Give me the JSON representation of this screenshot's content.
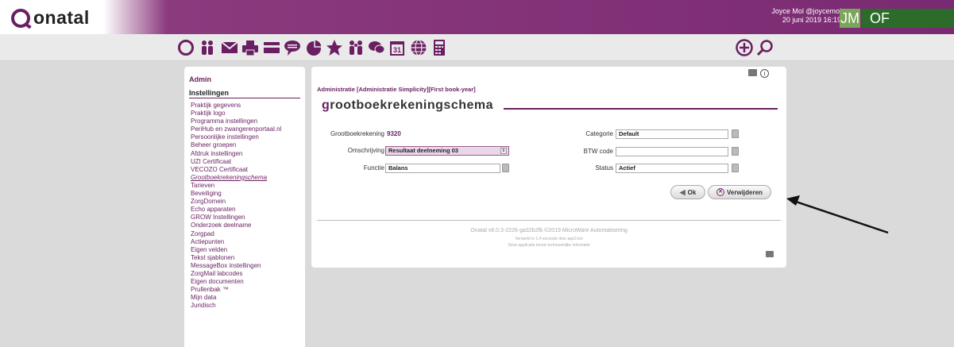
{
  "app": {
    "logo_text": "onatal"
  },
  "user": {
    "name": "Joyce Mol @joycemol",
    "datetime": "20 juni 2019 16:19",
    "initials": "JM",
    "org": "OF"
  },
  "toolbar": {
    "icons": [
      "home-q-icon",
      "persons-icon",
      "mail-icon",
      "print-icon",
      "card-icon",
      "chat-bubble-icon",
      "pie-chart-icon",
      "star-icon",
      "people-icon",
      "comments-icon",
      "calendar-icon",
      "globe-icon",
      "calculator-icon"
    ],
    "calendar_day": "31",
    "add_icon": "plus-circle-icon",
    "search_icon": "search-icon"
  },
  "sidebar": {
    "admin": "Admin",
    "section": "Instellingen",
    "items": [
      "Praktijk gegevens",
      "Praktijk logo",
      "Programma instellingen",
      "PeriHub en zwangerenportaal.nl",
      "Persoonlijke instellingen",
      "Beheer groepen",
      "Afdruk instellingen",
      "UZI Certificaat",
      "VECOZO Certificaat",
      "Grootboekrekeningschema",
      "Tarieven",
      "Beveiliging",
      "ZorgDomein",
      "Echo apparaten",
      "GROW Instellingen",
      "Onderzoek deelname",
      "Zorgpad",
      "Actiepunten",
      "Eigen velden",
      "Tekst sjablonen",
      "MessageBox instellingen",
      "ZorgMail labcodes",
      "Eigen documenten",
      "Prullenbak ™",
      "Mijn data",
      "Juridisch"
    ],
    "active_index": 9
  },
  "main": {
    "breadcrumb": "Administratie [Administratie Simplicity][First book-year]",
    "title_first": "g",
    "title_rest": "rootboekrekeningschema",
    "form": {
      "grootboekrekening_label": "Grootboekrekening",
      "grootboekrekening_value": "9320",
      "omschrijving_label": "Omschrijving",
      "omschrijving_value": "Resultaat deelneming 03",
      "functie_label": "Functie",
      "functie_value": "Balans",
      "categorie_label": "Categorie",
      "categorie_value": "Default",
      "btw_label": "BTW code",
      "btw_value": "",
      "status_label": "Status",
      "status_value": "Actief"
    },
    "buttons": {
      "ok": "Ok",
      "delete": "Verwijderen"
    },
    "footer": {
      "version": "Onatal v8.0.3-2226-ga32b2fb ©2019 MicroWare Automatisering",
      "timing": "Verwerkt in 1.4 seconde door app2:ion",
      "confidential": "Deze applicatie bevat vertrouwelijke informatie"
    }
  },
  "colors": {
    "brand": "#6a1f62",
    "topbar": "#7a2a72",
    "org_green": "#2d6b2a",
    "initials_green": "#7ba55a"
  }
}
